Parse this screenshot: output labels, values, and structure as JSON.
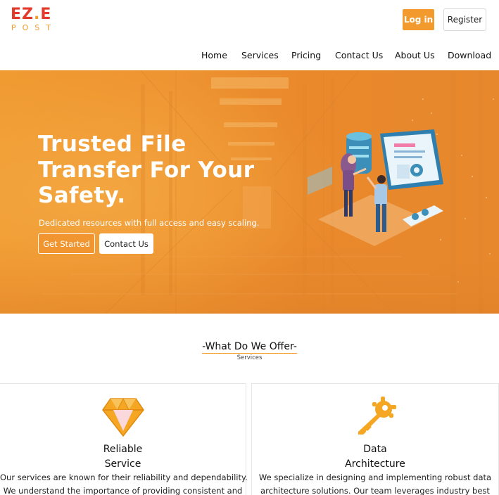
{
  "brand": {
    "logo_top": "EZ",
    "logo_dot": ".",
    "logo_e": "E",
    "logo_bottom": "POST",
    "colors": {
      "primary": "#f29a2e",
      "logo_red": "#e23b2b"
    }
  },
  "header": {
    "login_label": "Log in",
    "register_label": "Register"
  },
  "nav": {
    "items": [
      "Home",
      "Services",
      "Pricing",
      "Contact Us",
      "About Us",
      "Download"
    ]
  },
  "hero": {
    "title_lines": [
      "Trusted File",
      "Transfer For Your",
      "Safety."
    ],
    "subtitle": "Dedicated resources with full access and easy scaling.",
    "primary_button": "Get Started",
    "secondary_button": "Contact Us",
    "illustration": "people-with-data-dashboard-illustration"
  },
  "offer": {
    "title": "-What Do We Offer-",
    "subtitle": "Services",
    "cards": [
      {
        "icon": "diamond-icon",
        "title_lines": [
          "Reliable",
          "Service"
        ],
        "text_lines": [
          "Our services are known for their reliability and dependability.",
          "We understand the importance of providing consistent and"
        ]
      },
      {
        "icon": "key-icon",
        "title_lines": [
          "Data",
          "Architecture"
        ],
        "text_lines": [
          "We specialize in designing and implementing robust data",
          "architecture solutions. Our team leverages industry best"
        ]
      }
    ]
  }
}
